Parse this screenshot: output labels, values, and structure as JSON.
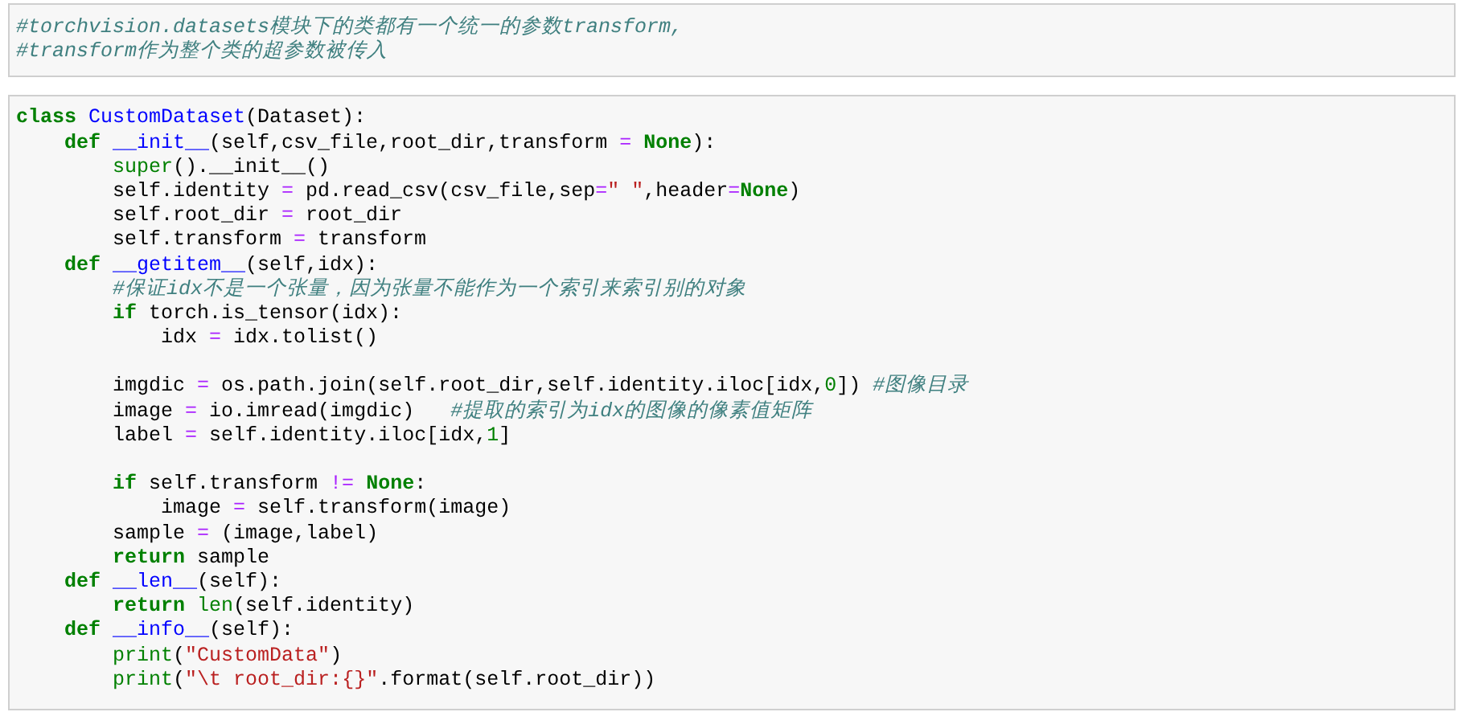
{
  "cells": [
    {
      "lines": [
        {
          "kind": "code",
          "tokens": [
            {
              "kind": "comment",
              "text": "#torchvision.datasets模块下的类都有一个统一的参数transform,"
            }
          ]
        },
        {
          "kind": "code",
          "tokens": [
            {
              "kind": "comment",
              "text": "#transform作为整个类的超参数被传入"
            }
          ]
        }
      ]
    },
    {
      "lines": [
        {
          "kind": "code",
          "tokens": [
            {
              "kind": "keyword",
              "text": "class"
            },
            {
              "kind": "defname",
              "text": " CustomDataset"
            },
            {
              "kind": "plain",
              "text": "(Dataset):"
            }
          ]
        },
        {
          "kind": "code",
          "tokens": [
            {
              "kind": "keyword",
              "text": "    def"
            },
            {
              "kind": "defname",
              "text": " __init__"
            },
            {
              "kind": "plain",
              "text": "(self,csv_file,root_dir,transform "
            },
            {
              "kind": "operator",
              "text": "="
            },
            {
              "kind": "keyword",
              "text": " None"
            },
            {
              "kind": "plain",
              "text": "):"
            }
          ]
        },
        {
          "kind": "code",
          "tokens": [
            {
              "kind": "builtin",
              "text": "        super"
            },
            {
              "kind": "plain",
              "text": "().__init__()"
            }
          ]
        },
        {
          "kind": "code",
          "tokens": [
            {
              "kind": "plain",
              "text": "        self.identity "
            },
            {
              "kind": "operator",
              "text": "="
            },
            {
              "kind": "plain",
              "text": " pd.read_csv(csv_file,sep"
            },
            {
              "kind": "operator",
              "text": "="
            },
            {
              "kind": "string",
              "text": "\" \""
            },
            {
              "kind": "plain",
              "text": ",header"
            },
            {
              "kind": "operator",
              "text": "="
            },
            {
              "kind": "keyword",
              "text": "None"
            },
            {
              "kind": "plain",
              "text": ")"
            }
          ]
        },
        {
          "kind": "code",
          "tokens": [
            {
              "kind": "plain",
              "text": "        self.root_dir "
            },
            {
              "kind": "operator",
              "text": "="
            },
            {
              "kind": "plain",
              "text": " root_dir"
            }
          ]
        },
        {
          "kind": "code",
          "tokens": [
            {
              "kind": "plain",
              "text": "        self.transform "
            },
            {
              "kind": "operator",
              "text": "="
            },
            {
              "kind": "plain",
              "text": " transform"
            }
          ]
        },
        {
          "kind": "code",
          "tokens": [
            {
              "kind": "keyword",
              "text": "    def"
            },
            {
              "kind": "defname",
              "text": " __getitem__"
            },
            {
              "kind": "plain",
              "text": "(self,idx):"
            }
          ]
        },
        {
          "kind": "code",
          "tokens": [
            {
              "kind": "comment",
              "text": "        #保证idx不是一个张量，因为张量不能作为一个索引来索引别的对象"
            }
          ]
        },
        {
          "kind": "code",
          "tokens": [
            {
              "kind": "keyword",
              "text": "        if"
            },
            {
              "kind": "plain",
              "text": " torch.is_tensor(idx):"
            }
          ]
        },
        {
          "kind": "code",
          "tokens": [
            {
              "kind": "plain",
              "text": "            idx "
            },
            {
              "kind": "operator",
              "text": "="
            },
            {
              "kind": "plain",
              "text": " idx.tolist()"
            }
          ]
        },
        {
          "kind": "blank"
        },
        {
          "kind": "code",
          "tokens": [
            {
              "kind": "plain",
              "text": "        imgdic "
            },
            {
              "kind": "operator",
              "text": "="
            },
            {
              "kind": "plain",
              "text": " os.path.join(self.root_dir,self.identity.iloc[idx,"
            },
            {
              "kind": "number",
              "text": "0"
            },
            {
              "kind": "plain",
              "text": "]) "
            },
            {
              "kind": "comment",
              "text": "#图像目录"
            }
          ]
        },
        {
          "kind": "code",
          "tokens": [
            {
              "kind": "plain",
              "text": "        image "
            },
            {
              "kind": "operator",
              "text": "="
            },
            {
              "kind": "plain",
              "text": " io.imread(imgdic)   "
            },
            {
              "kind": "comment",
              "text": "#提取的索引为idx的图像的像素值矩阵"
            }
          ]
        },
        {
          "kind": "code",
          "tokens": [
            {
              "kind": "plain",
              "text": "        label "
            },
            {
              "kind": "operator",
              "text": "="
            },
            {
              "kind": "plain",
              "text": " self.identity.iloc[idx,"
            },
            {
              "kind": "number",
              "text": "1"
            },
            {
              "kind": "plain",
              "text": "]"
            }
          ]
        },
        {
          "kind": "blank"
        },
        {
          "kind": "code",
          "tokens": [
            {
              "kind": "keyword",
              "text": "        if"
            },
            {
              "kind": "plain",
              "text": " self.transform "
            },
            {
              "kind": "operator",
              "text": "!="
            },
            {
              "kind": "keyword",
              "text": " None"
            },
            {
              "kind": "plain",
              "text": ":"
            }
          ]
        },
        {
          "kind": "code",
          "tokens": [
            {
              "kind": "plain",
              "text": "            image "
            },
            {
              "kind": "operator",
              "text": "="
            },
            {
              "kind": "plain",
              "text": " self.transform(image)"
            }
          ]
        },
        {
          "kind": "code",
          "tokens": [
            {
              "kind": "plain",
              "text": "        sample "
            },
            {
              "kind": "operator",
              "text": "="
            },
            {
              "kind": "plain",
              "text": " (image,label)"
            }
          ]
        },
        {
          "kind": "code",
          "tokens": [
            {
              "kind": "keyword",
              "text": "        return"
            },
            {
              "kind": "plain",
              "text": " sample"
            }
          ]
        },
        {
          "kind": "code",
          "tokens": [
            {
              "kind": "keyword",
              "text": "    def"
            },
            {
              "kind": "defname",
              "text": " __len__"
            },
            {
              "kind": "plain",
              "text": "(self):"
            }
          ]
        },
        {
          "kind": "code",
          "tokens": [
            {
              "kind": "keyword",
              "text": "        return"
            },
            {
              "kind": "builtin",
              "text": " len"
            },
            {
              "kind": "plain",
              "text": "(self.identity)"
            }
          ]
        },
        {
          "kind": "code",
          "tokens": [
            {
              "kind": "keyword",
              "text": "    def"
            },
            {
              "kind": "defname",
              "text": " __info__"
            },
            {
              "kind": "plain",
              "text": "(self):"
            }
          ]
        },
        {
          "kind": "code",
          "tokens": [
            {
              "kind": "builtin",
              "text": "        print"
            },
            {
              "kind": "plain",
              "text": "("
            },
            {
              "kind": "string",
              "text": "\"CustomData\""
            },
            {
              "kind": "plain",
              "text": ")"
            }
          ]
        },
        {
          "kind": "code",
          "tokens": [
            {
              "kind": "builtin",
              "text": "        print"
            },
            {
              "kind": "plain",
              "text": "("
            },
            {
              "kind": "string",
              "text": "\"\\t root_dir:{}\""
            },
            {
              "kind": "plain",
              "text": ".format(self.root_dir))"
            }
          ]
        }
      ]
    }
  ]
}
